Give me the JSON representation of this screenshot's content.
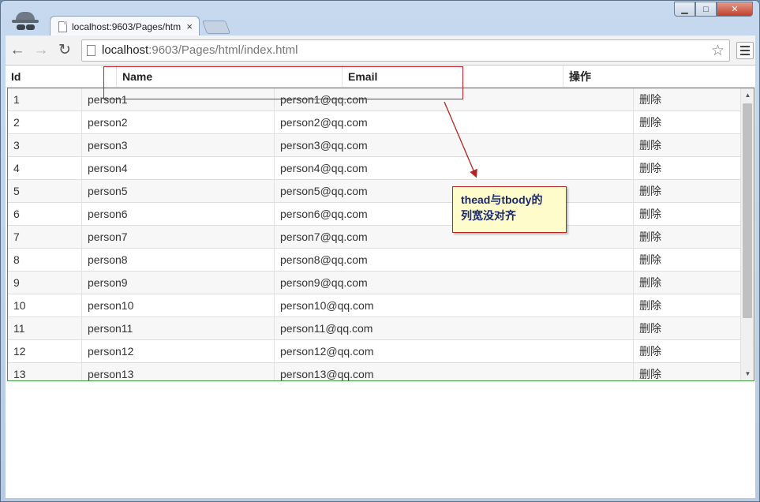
{
  "browser": {
    "tab_title": "localhost:9603/Pages/htm",
    "tab_close": "×",
    "url_host": "localhost",
    "url_rest": ":9603/Pages/html/index.html",
    "window_buttons": {
      "minimize": "▁",
      "maximize": "□",
      "close": "✕"
    },
    "nav": {
      "back": "←",
      "forward": "→",
      "reload": "↻",
      "star": "☆"
    }
  },
  "table": {
    "headers": [
      "Id",
      "Name",
      "Email",
      "操作"
    ],
    "rows": [
      {
        "id": "1",
        "name": "person1",
        "email": "person1@qq.com",
        "action": "删除"
      },
      {
        "id": "2",
        "name": "person2",
        "email": "person2@qq.com",
        "action": "删除"
      },
      {
        "id": "3",
        "name": "person3",
        "email": "person3@qq.com",
        "action": "删除"
      },
      {
        "id": "4",
        "name": "person4",
        "email": "person4@qq.com",
        "action": "删除"
      },
      {
        "id": "5",
        "name": "person5",
        "email": "person5@qq.com",
        "action": "删除"
      },
      {
        "id": "6",
        "name": "person6",
        "email": "person6@qq.com",
        "action": "删除"
      },
      {
        "id": "7",
        "name": "person7",
        "email": "person7@qq.com",
        "action": "删除"
      },
      {
        "id": "8",
        "name": "person8",
        "email": "person8@qq.com",
        "action": "删除"
      },
      {
        "id": "9",
        "name": "person9",
        "email": "person9@qq.com",
        "action": "删除"
      },
      {
        "id": "10",
        "name": "person10",
        "email": "person10@qq.com",
        "action": "删除"
      },
      {
        "id": "11",
        "name": "person11",
        "email": "person11@qq.com",
        "action": "删除"
      },
      {
        "id": "12",
        "name": "person12",
        "email": "person12@qq.com",
        "action": "删除"
      },
      {
        "id": "13",
        "name": "person13",
        "email": "person13@qq.com",
        "action": "删除"
      }
    ]
  },
  "annotation": {
    "callout_text": "thead与tbody的\n列宽没对齐",
    "border_color": "#c8202a",
    "fill_color": "#fffccc",
    "text_color": "#1a2a6a"
  },
  "colors": {
    "tbody_border": "#3e9a3e",
    "frame": "#b6cbe3"
  }
}
